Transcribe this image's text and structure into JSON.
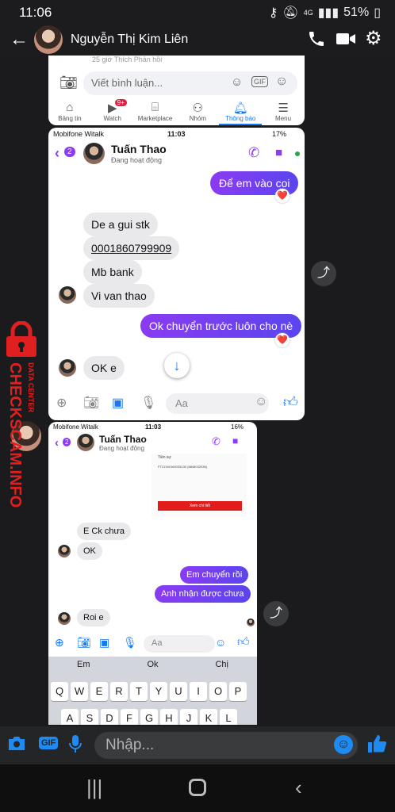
{
  "status": {
    "time": "11:06",
    "battery": "51%",
    "network": "4G"
  },
  "header": {
    "contact_name": "Nguyễn Thị Kim Liên"
  },
  "shot1": {
    "partial_text": "25 giờ   Thích   Phản hồi",
    "comment_placeholder": "Viết bình luận...",
    "gif_label": "GIF",
    "tabs": [
      {
        "label": "Bảng tin"
      },
      {
        "label": "Watch",
        "badge": "9+"
      },
      {
        "label": "Marketplace"
      },
      {
        "label": "Nhóm"
      },
      {
        "label": "Thông báo"
      },
      {
        "label": "Menu"
      }
    ]
  },
  "shot2": {
    "carrier": "Mobifone Witalk",
    "time": "11:03",
    "battery": "17%",
    "back_count": "2",
    "name": "Tuấn Thao",
    "presence": "Đang hoạt động",
    "messages": [
      {
        "dir": "out",
        "text": "Để em vào coi",
        "reaction": "❤️"
      },
      {
        "dir": "in",
        "text": "De a gui stk"
      },
      {
        "dir": "in",
        "text": "0001860799909"
      },
      {
        "dir": "in",
        "text": "Mb bank"
      },
      {
        "dir": "in",
        "text": "Vi van thao"
      },
      {
        "dir": "out",
        "text": "Ok chuyển trước luôn cho nè",
        "reaction": "❤️"
      },
      {
        "dir": "in",
        "text": "OK e"
      }
    ],
    "composer_placeholder": "Aa"
  },
  "shot3": {
    "carrier": "Mobifone Witalk",
    "time": "11:03",
    "battery": "16%",
    "back_count": "2",
    "name": "Tuấn Thao",
    "presence": "Đang hoạt động",
    "receipt_title": "Tiền sự",
    "receipt_line": "FT21340160035130 (8848032036)",
    "receipt_button": "Xem chi tiết",
    "messages": [
      {
        "dir": "in",
        "text": "E Ck chưa"
      },
      {
        "dir": "in",
        "text": "OK"
      },
      {
        "dir": "out",
        "text": "Em chuyển rồi"
      },
      {
        "dir": "out",
        "text": "Anh nhận được chưa"
      },
      {
        "dir": "in",
        "text": "Roi e"
      }
    ],
    "composer_placeholder": "Aa",
    "suggestions": [
      "Em",
      "Ok",
      "Chị"
    ],
    "keys_row1": [
      "Q",
      "W",
      "E",
      "R",
      "T",
      "Y",
      "U",
      "I",
      "O",
      "P"
    ],
    "keys_row2": [
      "A",
      "S",
      "D",
      "F",
      "G",
      "H",
      "J",
      "K",
      "L"
    ]
  },
  "watermark": {
    "text": "CHECKSCAM.INFO",
    "small": "DATA CENTER"
  },
  "bottom": {
    "gif_label": "GIF",
    "input_placeholder": "Nhập..."
  }
}
